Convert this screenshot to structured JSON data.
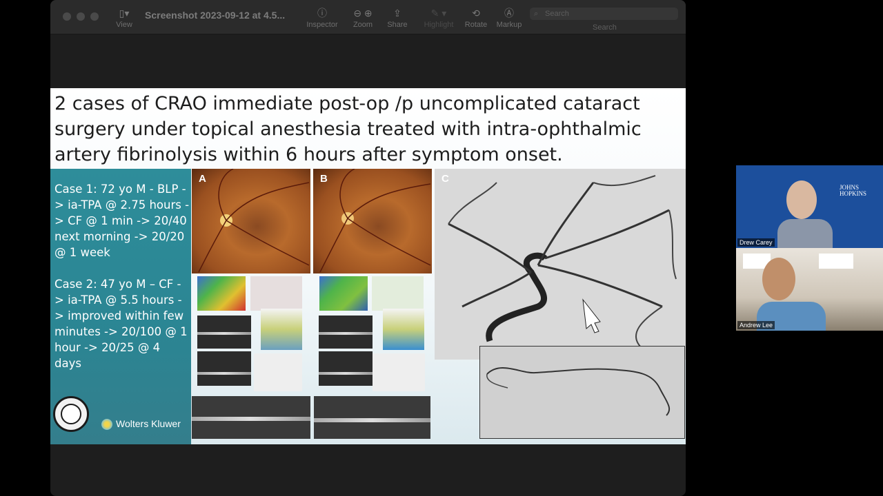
{
  "window": {
    "title": "Screenshot 2023-09-12 at 4.5...",
    "toolbar": {
      "view_label": "View",
      "inspector_label": "Inspector",
      "zoom_label": "Zoom",
      "share_label": "Share",
      "highlight_label": "Highlight",
      "rotate_label": "Rotate",
      "markup_label": "Markup",
      "search_placeholder": "Search",
      "search_label": "Search"
    }
  },
  "slide": {
    "title": "2 cases of CRAO immediate post-op /p uncomplicated cataract surgery under topical anesthesia treated with intra-ophthalmic artery fibrinolysis within 6 hours after symptom onset.",
    "case1": "Case 1: 72 yo M - BLP -> ia-TPA @ 2.75 hours -> CF @ 1 min -> 20/40 next morning -> 20/20 @ 1 week",
    "case2": "Case 2: 47 yo M – CF -> ia-TPA @ 5.5 hours -> improved within few minutes -> 20/100 @ 1 hour -> 20/25 @ 4 days",
    "publisher": "Wolters Kluwer",
    "panel_labels": [
      "A",
      "B",
      "C"
    ]
  },
  "participants": [
    {
      "name": "Drew Carey",
      "logo_text": "JOHNS HOPKINS"
    },
    {
      "name": "Andrew Lee"
    }
  ],
  "colors": {
    "panel_teal": "#2e8d9a",
    "window_bg": "#1e1e1e",
    "video_bg_1": "#1c4f9c"
  }
}
